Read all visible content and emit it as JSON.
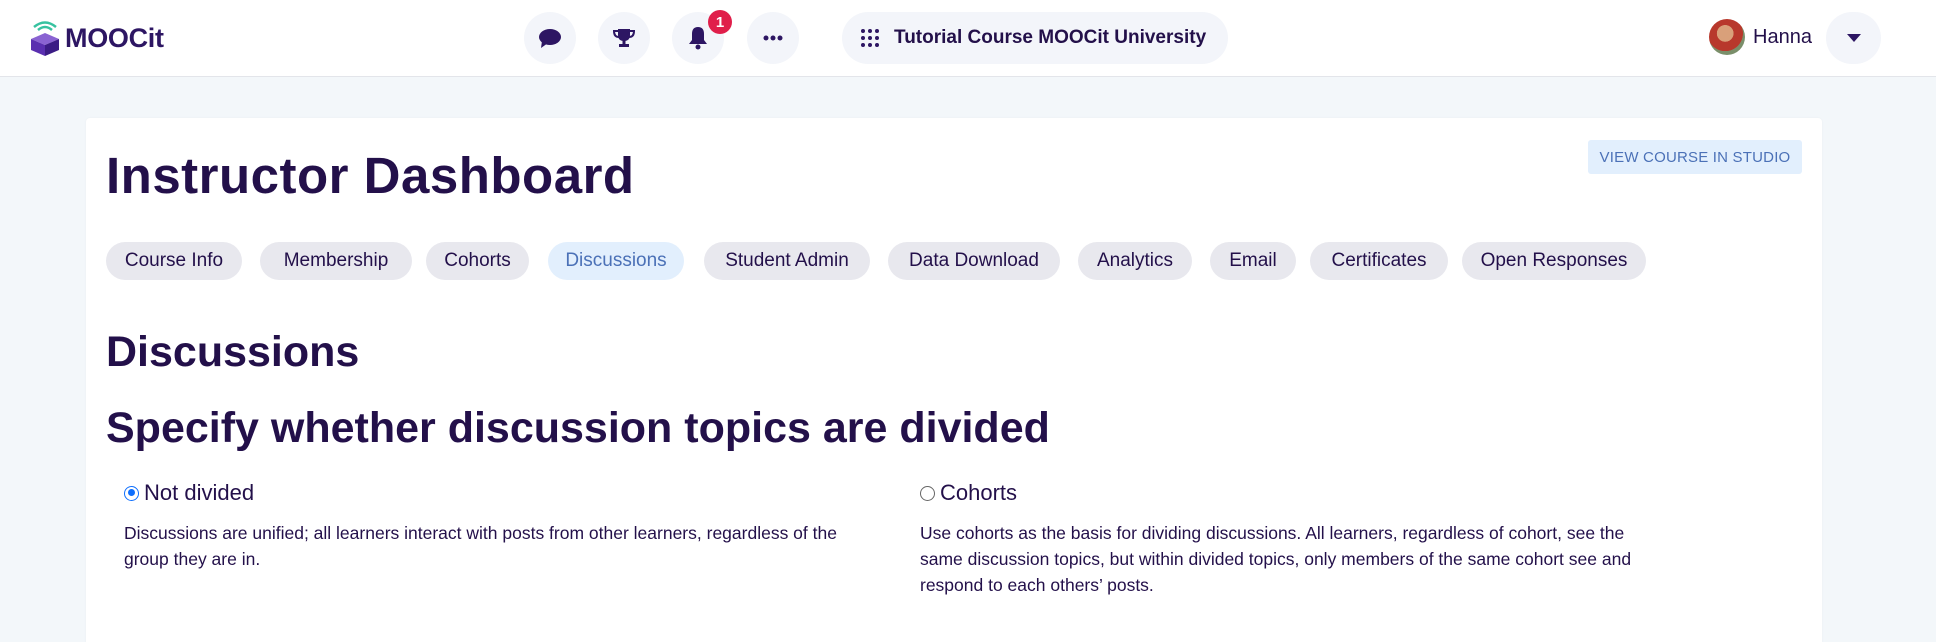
{
  "header": {
    "logo_text": "MOOCit",
    "icons": [
      "chat-bubble-icon",
      "trophy-icon",
      "bell-icon",
      "ellipsis-icon"
    ],
    "notification_count": "1",
    "course_title": "Tutorial Course MOOCit University",
    "user_name": "Hanna"
  },
  "dashboard": {
    "title": "Instructor Dashboard",
    "studio_button": "VIEW COURSE IN STUDIO",
    "tabs": [
      {
        "label": "Course Info"
      },
      {
        "label": "Membership"
      },
      {
        "label": "Cohorts"
      },
      {
        "label": "Discussions",
        "active": true
      },
      {
        "label": "Student Admin"
      },
      {
        "label": "Data Download"
      },
      {
        "label": "Analytics"
      },
      {
        "label": "Email"
      },
      {
        "label": "Certificates"
      },
      {
        "label": "Open Responses"
      }
    ]
  },
  "discussions": {
    "heading": "Discussions",
    "subheading": "Specify whether discussion topics are divided",
    "options": [
      {
        "label": "Not divided",
        "selected": true,
        "description_lines": [
          "Discussions are unified; all learners interact with posts from other learners, regardless of the",
          "group they are in."
        ]
      },
      {
        "label": "Cohorts",
        "selected": false,
        "description_lines": [
          "Use cohorts as the basis for dividing discussions. All learners, regardless of cohort, see the",
          "same discussion topics, but within divided topics, only members of the same cohort see and",
          "respond to each others’ posts."
        ]
      }
    ]
  },
  "colors": {
    "brand_dark": "#23104a",
    "accent_blue": "#4b71b7",
    "accent_light": "#e2effd",
    "badge_red": "#e01e4a",
    "background": "#f3f7fa"
  }
}
